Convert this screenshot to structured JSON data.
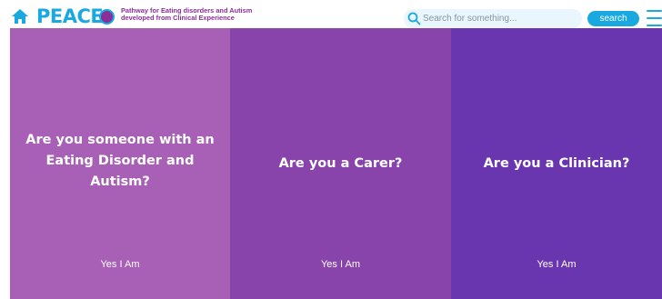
{
  "header": {
    "logo_text": "PEACE",
    "tagline_line1": "Pathway for Eating disorders and Autism",
    "tagline_line2": "developed from Clinical Experience",
    "search_placeholder": "Search for something...",
    "search_button_label": "search"
  },
  "panels": [
    {
      "question": "Are you someone with an Eating Disorder and Autism?",
      "answer": "Yes I Am",
      "color": "#a85fb6"
    },
    {
      "question": "Are you a Carer?",
      "answer": "Yes I Am",
      "color": "#8944ac"
    },
    {
      "question": "Are you a Clinician?",
      "answer": "Yes I Am",
      "color": "#6a36b0"
    }
  ],
  "colors": {
    "brand_blue": "#19a9e0",
    "brand_purple": "#8a2f98"
  },
  "icons": [
    "home-icon",
    "logo-dot",
    "search-icon",
    "menu-icon"
  ]
}
